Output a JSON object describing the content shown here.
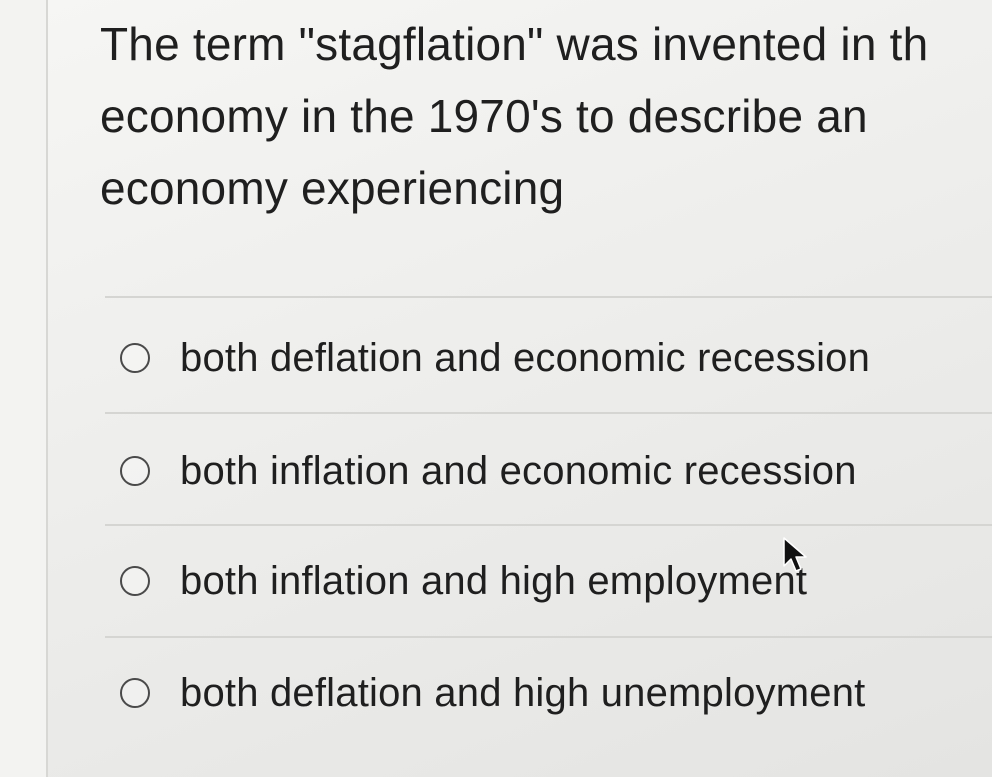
{
  "question": {
    "lines": [
      "The term \"stagflation\" was invented in th",
      "economy in the 1970's to describe an",
      "economy experiencing"
    ]
  },
  "options": [
    {
      "label": "both deflation and economic recession",
      "selected": false
    },
    {
      "label": "both inflation and economic recession",
      "selected": false
    },
    {
      "label": "both inflation and high employment",
      "selected": false
    },
    {
      "label": "both deflation and high unemployment",
      "selected": false
    }
  ]
}
